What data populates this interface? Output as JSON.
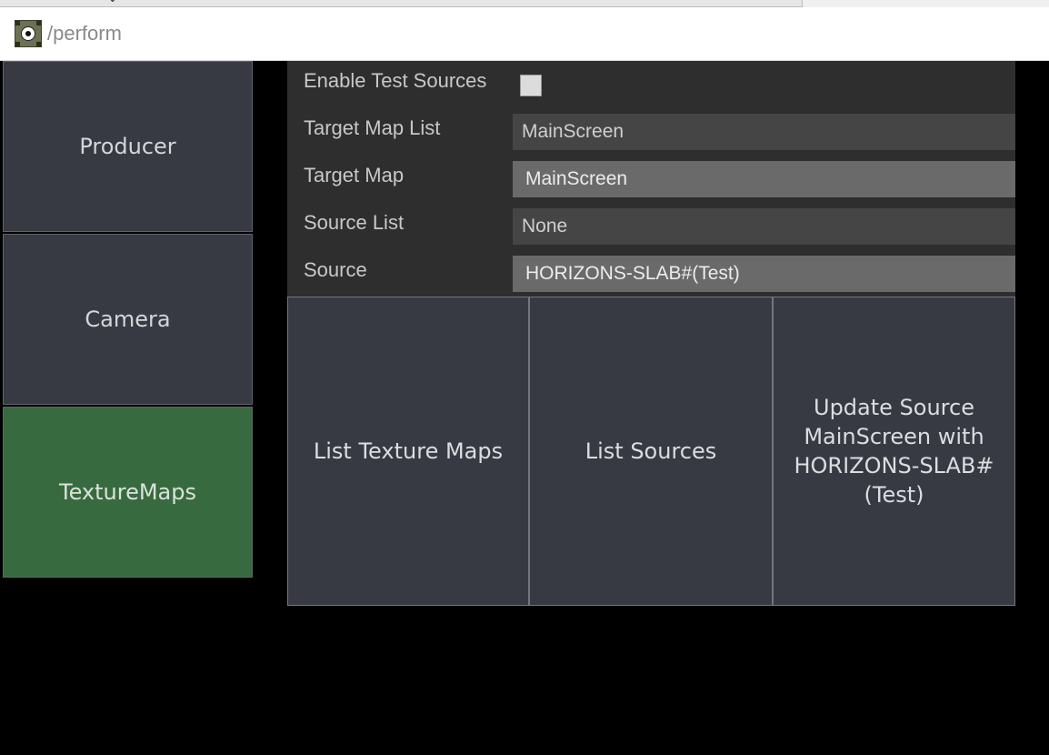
{
  "window": {
    "title": "/perform"
  },
  "nav": {
    "items": [
      {
        "label": "Producer",
        "active": false
      },
      {
        "label": "Camera",
        "active": false
      },
      {
        "label": "TextureMaps",
        "active": true
      }
    ]
  },
  "params": {
    "enable_test_sources": {
      "label": "Enable Test Sources",
      "checked": true
    },
    "target_map_list": {
      "label": "Target Map List",
      "value": "MainScreen"
    },
    "target_map": {
      "label": "Target Map",
      "value": "MainScreen"
    },
    "source_list": {
      "label": "Source List",
      "value": "None"
    },
    "source": {
      "label": "Source",
      "value": "HORIZONS-SLAB#(Test)"
    }
  },
  "actions": {
    "list_texture_maps": "List Texture Maps",
    "list_sources": "List Sources",
    "update_source": "Update Source MainScreen with HORIZONS-SLAB#(Test)"
  },
  "colors": {
    "nav_bg": "#383a43",
    "nav_active": "#386a3f",
    "panel_bg": "#2e2e2f",
    "field_dark": "#454545",
    "field_light": "#6a6a6a"
  }
}
